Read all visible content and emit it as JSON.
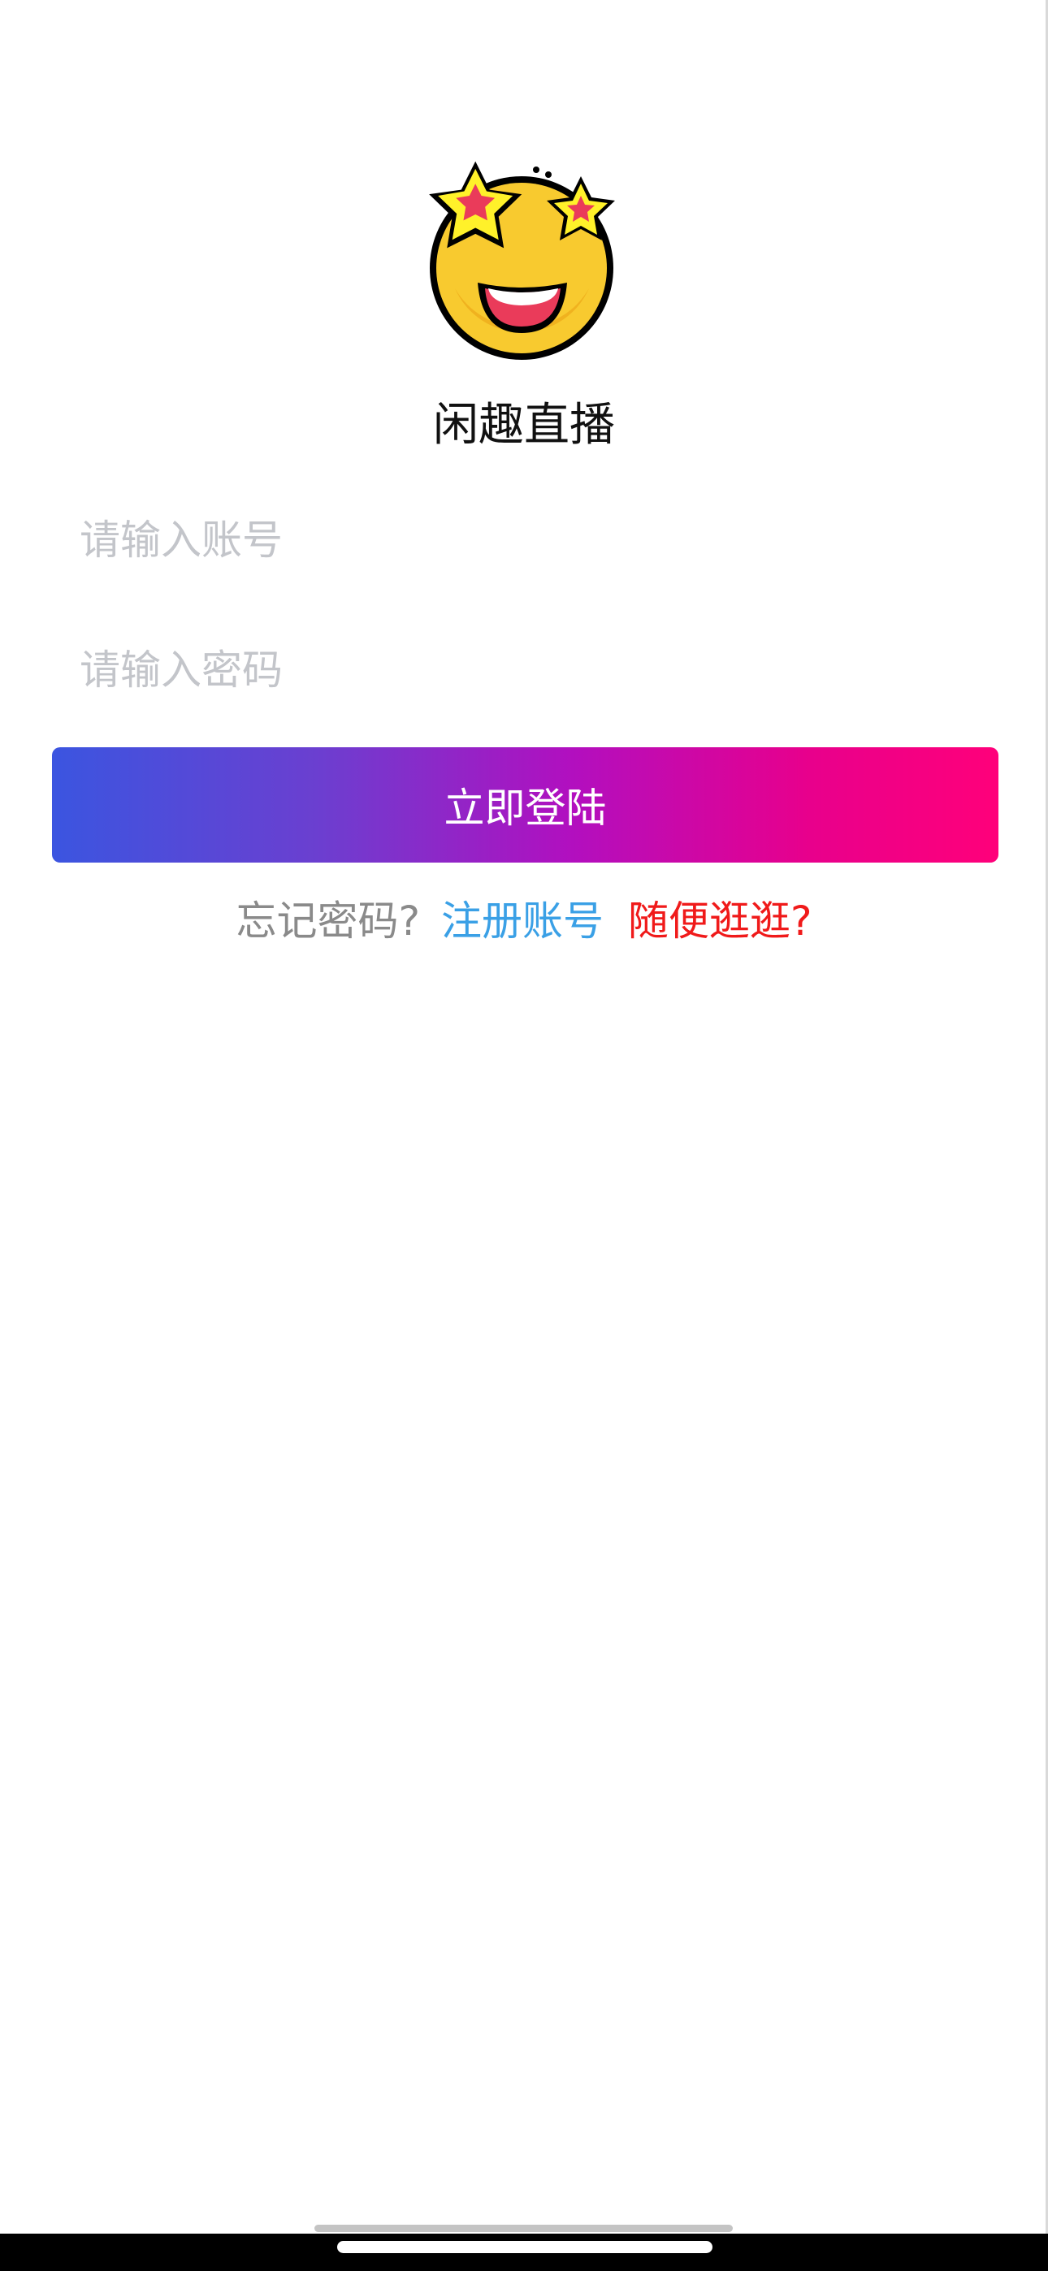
{
  "app": {
    "name": "闲趣直播"
  },
  "logo": {
    "icon": "star-struck-emoji-icon"
  },
  "form": {
    "account_placeholder": "请输入账号",
    "account_value": "",
    "password_placeholder": "请输入密码",
    "password_value": "",
    "login_label": "立即登陆"
  },
  "links": {
    "forgot": "忘记密码?",
    "register": "注册账号",
    "browse": "随便逛逛?"
  },
  "colors": {
    "gradient_start": "#3b55e0",
    "gradient_end": "#ff007a",
    "register_link": "#3aa0e6",
    "browse_link": "#f01a1a"
  }
}
